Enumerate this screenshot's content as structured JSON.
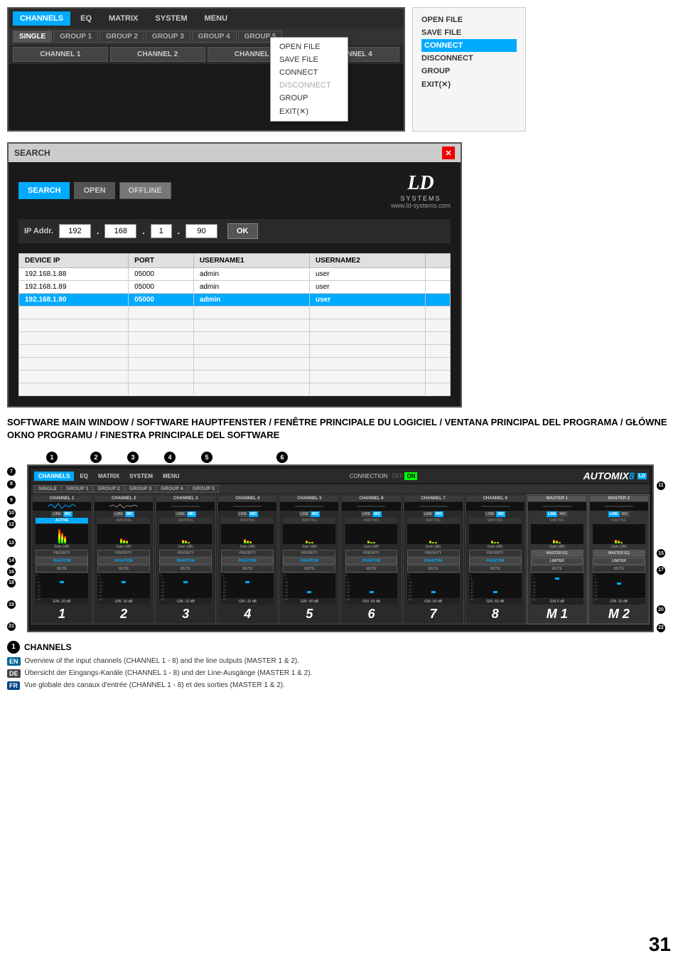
{
  "top": {
    "nav": {
      "channels_label": "CHANNELS",
      "eq_label": "EQ",
      "matrix_label": "MATRIX",
      "system_label": "SYSTEM",
      "menu_label": "MENU"
    },
    "groups": [
      "SINGLE",
      "GROUP 1",
      "GROUP 2",
      "GROUP 3",
      "GROUP 4",
      "GROUP 5"
    ],
    "channels": [
      "CHANNEL 1",
      "CHANNEL 2",
      "CHANNEL 3",
      "CHANNEL 4"
    ],
    "dropdown": {
      "items": [
        "OPEN FILE",
        "SAVE FILE",
        "CONNECT",
        "DISCONNECT",
        "GROUP",
        "EXIT(✕)"
      ]
    }
  },
  "right_panel": {
    "items": [
      "OPEN FILE",
      "SAVE FILE",
      "CONNECT",
      "DISCONNECT",
      "GROUP",
      "EXIT(✕)"
    ]
  },
  "search_dialog": {
    "title": "SEARCH",
    "modes": [
      "SEARCH",
      "OPEN",
      "OFFLINE"
    ],
    "ip_label": "IP Addr.",
    "ip_parts": [
      "192",
      "168",
      "1",
      "90"
    ],
    "ok_label": "OK",
    "ld_logo": "LD",
    "ld_systems": "SYSTEMS",
    "ld_website": "www.ld-systems.com",
    "table_headers": [
      "DEVICE IP",
      "PORT",
      "USERNAME1",
      "USERNAME2"
    ],
    "table_rows": [
      {
        "ip": "192.168.1.88",
        "port": "05000",
        "user1": "admin",
        "user2": "user"
      },
      {
        "ip": "192.168.1.89",
        "port": "05000",
        "user1": "admin",
        "user2": "user"
      },
      {
        "ip": "192.168.1.90",
        "port": "05000",
        "user1": "admin",
        "user2": "user"
      }
    ]
  },
  "description": {
    "title": "SOFTWARE MAIN WINDOW / SOFTWARE HAUPTFENSTER / FENÊTRE PRINCIPALE DU LOGICIEL / VENTANA PRINCIPAL DEL PROGRAMA / GŁÓWNE OKNO PROGRAMU / FINESTRA PRINCIPALE DEL SOFTWARE"
  },
  "main_ui": {
    "connection": "CONNECTION",
    "off_label": "OFF",
    "on_label": "ON",
    "automix_label": "AUTOMIX",
    "automix_num": "8",
    "channels": [
      "CHANNEL 1",
      "CHANNEL 2",
      "CHANNEL 3",
      "CHANNEL 4",
      "CHANNEL 5",
      "CHANNEL 6",
      "CHANNEL 7",
      "CHANNEL 8",
      "MASTER 1",
      "MASTER 2"
    ],
    "big_numbers": [
      "1",
      "2",
      "3",
      "4",
      "5",
      "6",
      "7",
      "8",
      "M 1",
      "M 2"
    ],
    "gain_values": [
      "-10 dB",
      "-10 dB",
      "-10 dB",
      "-10 dB",
      "-50 dB",
      "-50 dB",
      "-50 dB",
      "-50 dB",
      "0 dB",
      "-20 dB"
    ]
  },
  "annotations": {
    "number": "1",
    "title": "CHANNELS",
    "items": [
      {
        "lang": "EN",
        "text": "Overview of the input channels (CHANNEL 1 - 8) and the line outputs (MASTER 1 & 2)."
      },
      {
        "lang": "DE",
        "text": "Übersicht der Eingangs-Kanäle (CHANNEL 1 - 8) und der Line-Ausgänge (MASTER 1 & 2)."
      },
      {
        "lang": "FR",
        "text": "Vue globale des canaux d'entrée (CHANNEL 1 - 8) et des sorties (MASTER 1 & 2)."
      }
    ]
  },
  "page_number": "31",
  "num_labels": {
    "row1": [
      "①",
      "②",
      "③",
      "④",
      "⑤",
      "⑥"
    ],
    "side": [
      "⑦",
      "⑧",
      "⑨",
      "⑩",
      "⑪",
      "⑫",
      "⑬",
      "⑭",
      "⑮",
      "⑯",
      "⑰",
      "⑱",
      "⑲",
      "⑳",
      "㉑",
      "㉒"
    ]
  }
}
